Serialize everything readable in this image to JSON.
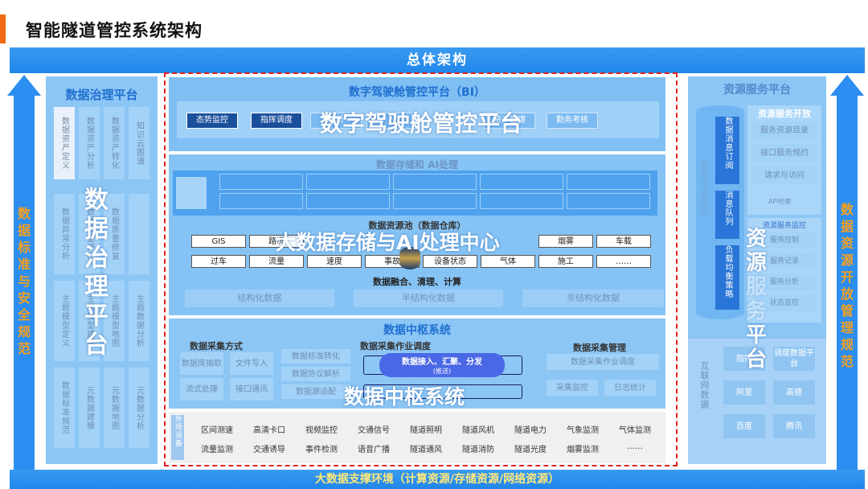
{
  "page_title": "智能隧道管控系统架构",
  "top_bar": "总体架构",
  "bottom_bar": "大数据支撑环境（计算资源/存储资源/网络资源）",
  "left_arrow_text": "数据标准与安全规范",
  "right_arrow_text": "数据资源开放管理规范",
  "governance": {
    "title": "数据治理平台",
    "overlay": "数据治理平台",
    "cells": [
      "数据资产定义",
      "数据资产分析",
      "数据资产转化",
      "知识云图谱",
      "数据异常分析",
      "数据质量评价",
      "数据质量修复",
      "主题模型定义",
      "主题模型建模",
      "主题模型地图",
      "主题数据分析",
      "数据标准规范",
      "元数据建模",
      "元数据地图",
      "元数据分析"
    ]
  },
  "bi": {
    "title": "数字驾驶舱管控平台（BI）",
    "overlay": "数字驾驶舱管控平台",
    "buttons": [
      "态势监控",
      "指挥调度",
      "分析",
      "",
      "资产管理",
      "勤务考核"
    ]
  },
  "storage": {
    "title": "数据存储和 AI处理",
    "overlay": "大数据存储与AI处理中心",
    "resource_label": "数据资源池（数据仓库）",
    "tags_row1": [
      "GIS",
      "路况",
      "",
      "",
      "",
      "",
      "烟雾",
      "车载"
    ],
    "tags_row2": [
      "过车",
      "流量",
      "速度",
      "事故",
      "设备状态",
      "气体",
      "施工",
      "……"
    ],
    "fusion": "数据融合、清理、计算",
    "types": [
      "结构化数据",
      "半结构化数据",
      "非结构化数据"
    ]
  },
  "hub": {
    "title": "数据中枢系统",
    "overlay": "数据中枢系统",
    "collect_method": {
      "title": "数据采集方式",
      "items": [
        "数据库抽取",
        "文件写入",
        "流式处理",
        "接口通讯"
      ]
    },
    "collect_schedule": {
      "title": "数据采集作业调度",
      "items": [
        "数据标准转化",
        "数据协议解析",
        "数据源适配"
      ]
    },
    "pill_main": "数据接入、汇聚、分发",
    "pill_sub": "(推送)",
    "collect_manage": {
      "title": "数据采集管理",
      "items": [
        "数据采集作业调度",
        "采集监控",
        "日志统计"
      ]
    }
  },
  "devices": {
    "label": "外场设备",
    "row1": [
      "区间测速",
      "高清卡口",
      "视频监控",
      "交通信号",
      "隧道照明",
      "隧道风机",
      "隧道电力",
      "气象监测",
      "气体监测"
    ],
    "row2": [
      "流量监测",
      "交通诱导",
      "事件检测",
      "语音广播",
      "隧道通风",
      "隧道消防",
      "隧道光度",
      "烟雾监测",
      "……"
    ]
  },
  "resource": {
    "title": "资源服务平台",
    "overlay_chars": [
      "资",
      "源",
      "服",
      "务",
      "平",
      "台"
    ],
    "cylinder_label": "数据消息总线",
    "bus_items": [
      "数据消息订阅",
      "消息队列",
      "负载均衡策略"
    ],
    "open_title": "资源服务开放",
    "open_items": [
      "服务资源目录",
      "接口服务规约",
      "请求与访问"
    ],
    "api_title": "API检索",
    "monitor_title": "资源服务监控",
    "monitor_items": [
      "服务控制",
      "服务记录",
      "服务分析",
      "状态监控"
    ],
    "internet_label": "互联网数据",
    "internet_items": [
      "指挥",
      "调度数据平台",
      "阿里",
      "高德",
      "百度",
      "腾讯"
    ]
  }
}
